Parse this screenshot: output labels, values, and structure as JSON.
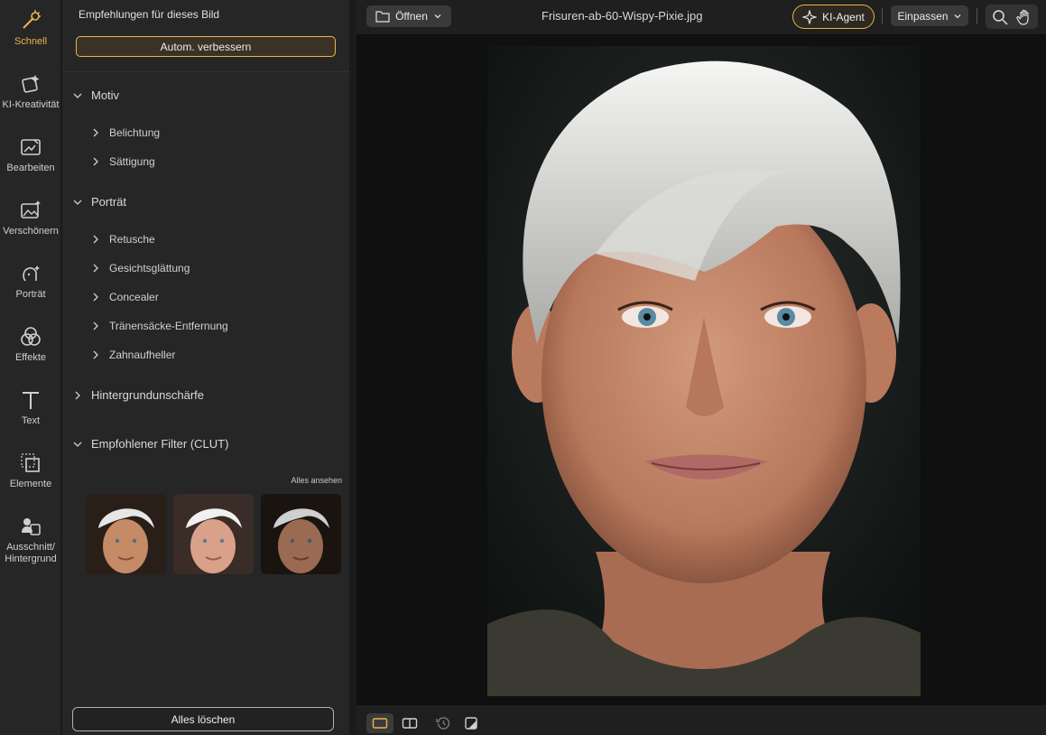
{
  "colors": {
    "accent": "#e9b44c",
    "panel": "#262626",
    "canvas": "#101010"
  },
  "rail": [
    {
      "label": "Schnell",
      "icon": "magic-wand-icon",
      "active": true
    },
    {
      "label": "KI-Kreativität",
      "icon": "ai-creativity-icon"
    },
    {
      "label": "Bearbeiten",
      "icon": "edit-image-icon"
    },
    {
      "label": "Verschönern",
      "icon": "beautify-icon"
    },
    {
      "label": "Porträt",
      "icon": "portrait-icon"
    },
    {
      "label": "Effekte",
      "icon": "effects-icon"
    },
    {
      "label": "Text",
      "icon": "text-icon"
    },
    {
      "label": "Elemente",
      "icon": "elements-icon"
    },
    {
      "label": "Ausschnitt/\nHintergrund",
      "icon": "cutout-icon"
    }
  ],
  "panel": {
    "title": "Empfehlungen für dieses Bild",
    "auto_button": "Autom. verbessern",
    "sections": [
      {
        "label": "Motiv",
        "expanded": true,
        "items": [
          "Belichtung",
          "Sättigung"
        ]
      },
      {
        "label": "Porträt",
        "expanded": true,
        "items": [
          "Retusche",
          "Gesichtsglättung",
          "Concealer",
          "Tränensäcke-Entfernung",
          "Zahnaufheller"
        ]
      },
      {
        "label": "Hintergrundunschärfe",
        "expanded": false,
        "items": []
      },
      {
        "label": "Empfohlener Filter (CLUT)",
        "expanded": true,
        "items": []
      }
    ],
    "see_all": "Alles ansehen",
    "clear_button": "Alles löschen"
  },
  "toolbar": {
    "open_label": "Öffnen",
    "filename": "Frisuren-ab-60-Wispy-Pixie.jpg",
    "ai_agent_label": "KI-Agent",
    "fit_label": "Einpassen"
  }
}
